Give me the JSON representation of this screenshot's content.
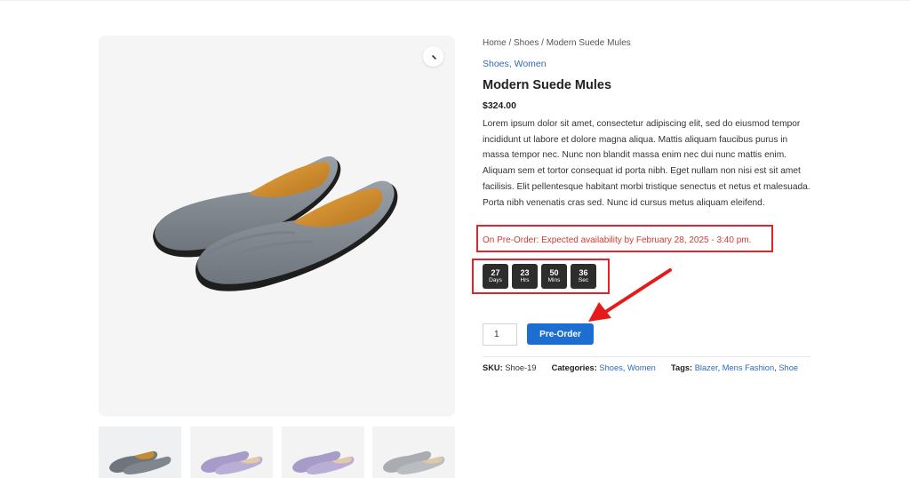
{
  "breadcrumb": "Home / Shoes / Modern Suede Mules",
  "top_categories": [
    "Shoes",
    "Women"
  ],
  "product": {
    "title": "Modern Suede Mules",
    "price": "$324.00",
    "description": "Lorem ipsum dolor sit amet, consectetur adipiscing elit, sed do eiusmod tempor incididunt ut labore et dolore magna aliqua. Mattis aliquam faucibus purus in massa tempor nec. Nunc non blandit massa enim nec dui nunc mattis enim. Aliquam sem et tortor consequat id porta nibh. Eget nullam non nisi est sit amet facilisis. Elit pellentesque habitant morbi tristique senectus et netus et malesuada. Porta nibh venenatis cras sed. Nunc id cursus metus aliquam eleifend."
  },
  "preorder_message": "On Pre-Order: Expected availability by February 28, 2025 - 3:40 pm.",
  "countdown": [
    {
      "value": "27",
      "unit": "Days"
    },
    {
      "value": "23",
      "unit": "Hrs"
    },
    {
      "value": "50",
      "unit": "Mins"
    },
    {
      "value": "36",
      "unit": "Sec"
    }
  ],
  "cart": {
    "quantity": "1",
    "button_label": "Pre-Order"
  },
  "meta": {
    "sku_label": "SKU:",
    "sku_value": "Shoe-19",
    "categories_label": "Categories:",
    "categories": [
      "Shoes",
      "Women"
    ],
    "tags_label": "Tags:",
    "tags": [
      "Blazer",
      "Mens Fashion",
      "Shoe"
    ]
  },
  "colors": {
    "accent": "#1c6fd1",
    "link": "#2e6ab8",
    "highlight": "#e0242c",
    "countdown_bg": "#2d2d2d"
  },
  "icons": {
    "zoom": "magnifier-icon",
    "annotation": "red-arrow-icon"
  }
}
